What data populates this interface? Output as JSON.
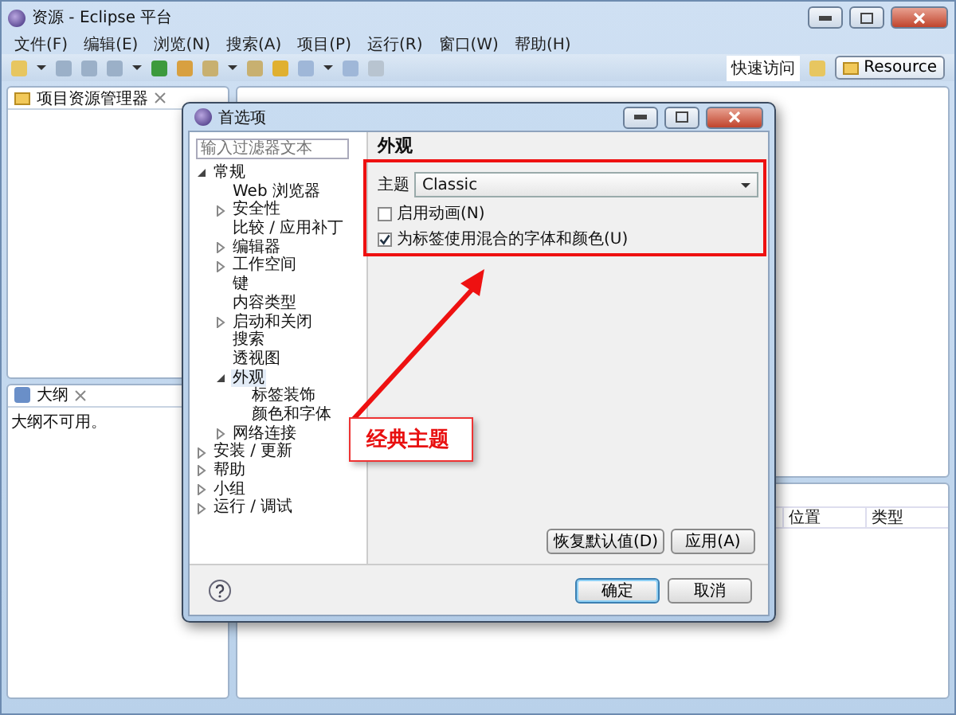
{
  "window": {
    "title": "资源 - Eclipse 平台"
  },
  "menu": [
    "文件(F)",
    "编辑(E)",
    "浏览(N)",
    "搜索(A)",
    "项目(P)",
    "运行(R)",
    "窗口(W)",
    "帮助(H)"
  ],
  "toolbar": {
    "quick_access": "快速访问",
    "perspective": "Resource"
  },
  "explorer": {
    "tab": "项目资源管理器"
  },
  "outline": {
    "tab": "大纲",
    "message": "大纲不可用。"
  },
  "problems": {
    "columns": [
      "位置",
      "类型"
    ]
  },
  "dialog": {
    "title": "首选项",
    "filter": {
      "placeholder": "输入过滤器文本"
    },
    "tree": [
      {
        "label": "常规",
        "kind": "branch",
        "expanded": true,
        "selected": false,
        "children": [
          {
            "label": "Web 浏览器",
            "kind": "leaf",
            "selected": false
          },
          {
            "label": "安全性",
            "kind": "branch",
            "expanded": false,
            "selected": false
          },
          {
            "label": "比较 / 应用补丁",
            "kind": "leaf",
            "selected": false
          },
          {
            "label": "编辑器",
            "kind": "branch",
            "expanded": false,
            "selected": false
          },
          {
            "label": "工作空间",
            "kind": "branch",
            "expanded": false,
            "selected": false
          },
          {
            "label": "键",
            "kind": "leaf",
            "selected": false
          },
          {
            "label": "内容类型",
            "kind": "leaf",
            "selected": false
          },
          {
            "label": "启动和关闭",
            "kind": "branch",
            "expanded": false,
            "selected": false
          },
          {
            "label": "搜索",
            "kind": "leaf",
            "selected": false
          },
          {
            "label": "透视图",
            "kind": "leaf",
            "selected": false
          },
          {
            "label": "外观",
            "kind": "branch",
            "expanded": true,
            "selected": true,
            "children": [
              {
                "label": "标签装饰",
                "kind": "leaf",
                "selected": false
              },
              {
                "label": "颜色和字体",
                "kind": "leaf",
                "selected": false
              }
            ]
          },
          {
            "label": "网络连接",
            "kind": "branch",
            "expanded": false,
            "selected": false
          }
        ]
      },
      {
        "label": "安装 / 更新",
        "kind": "branch",
        "expanded": false,
        "selected": false
      },
      {
        "label": "帮助",
        "kind": "branch",
        "expanded": false,
        "selected": false
      },
      {
        "label": "小组",
        "kind": "branch",
        "expanded": false,
        "selected": false
      },
      {
        "label": "运行 / 调试",
        "kind": "branch",
        "expanded": false,
        "selected": false
      }
    ],
    "page": {
      "title": "外观",
      "theme_label": "主题",
      "theme": "Classic",
      "options": [
        {
          "label": "启用动画(N)",
          "checked": false
        },
        {
          "label": "为标签使用混合的字体和颜色(U)",
          "checked": true
        }
      ],
      "buttons": [
        "恢复默认值(D)",
        "应用(A)"
      ]
    },
    "buttons": [
      {
        "label": "确定",
        "default": true
      },
      {
        "label": "取消",
        "default": false
      }
    ]
  },
  "annotation": {
    "label": "经典主题"
  }
}
